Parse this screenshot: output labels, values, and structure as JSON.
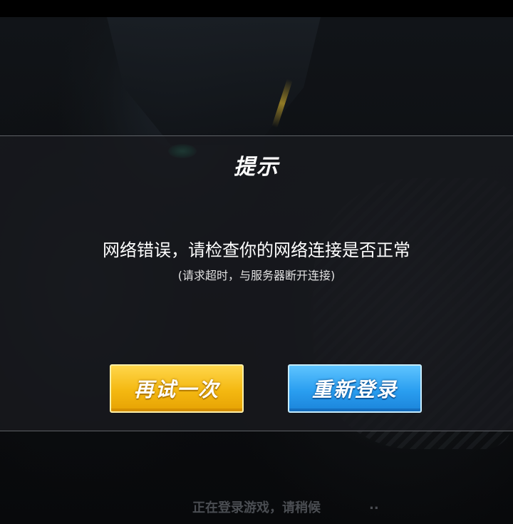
{
  "dialog": {
    "title": "提示",
    "message": "网络错误，请检查你的网络连接是否正常",
    "detail": "(请求超时，与服务器断开连接)",
    "buttons": {
      "retry_label": "再试一次",
      "relogin_label": "重新登录"
    }
  },
  "status": {
    "text": "正在登录游戏，请稍候",
    "dots": ".."
  },
  "colors": {
    "retry_button": "#f4b811",
    "relogin_button": "#2a9ef0",
    "dialog_background": "#181a1e",
    "accent_glow": "#3ee0a8"
  }
}
